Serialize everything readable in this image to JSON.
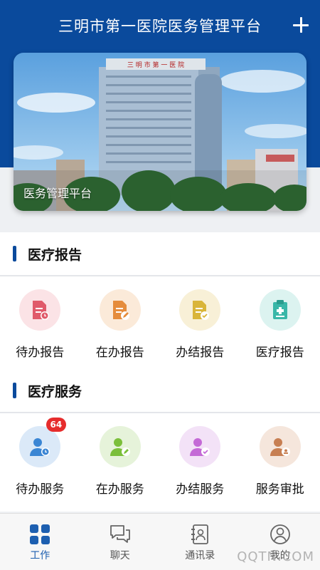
{
  "header": {
    "title": "三明市第一医院医务管理平台",
    "add_icon": "plus-icon"
  },
  "banner": {
    "caption": "医务管理平台",
    "building_sign": "三 明 市 第 一 医 院"
  },
  "reports": {
    "title": "医疗报告",
    "items": [
      {
        "label": "待办报告",
        "icon": "document-clock-icon",
        "color": "#e05a6a",
        "bg": "#fbe3e6"
      },
      {
        "label": "在办报告",
        "icon": "document-pen-icon",
        "color": "#e58c3c",
        "bg": "#fbead9"
      },
      {
        "label": "办结报告",
        "icon": "document-check-icon",
        "color": "#d9b53a",
        "bg": "#f8f0d7"
      },
      {
        "label": "医疗报告",
        "icon": "clipboard-icon",
        "color": "#39b7a8",
        "bg": "#dcf3f0"
      }
    ]
  },
  "services": {
    "title": "医疗服务",
    "items": [
      {
        "label": "待办服务",
        "icon": "user-clock-icon",
        "color": "#3b86d4",
        "bg": "#dbe9f8",
        "badge": "64"
      },
      {
        "label": "在办服务",
        "icon": "user-pen-icon",
        "color": "#7bbf3a",
        "bg": "#e6f3da"
      },
      {
        "label": "办结服务",
        "icon": "user-check-icon",
        "color": "#c46ad6",
        "bg": "#f3e2f7"
      },
      {
        "label": "服务审批",
        "icon": "user-approve-icon",
        "color": "#c77f52",
        "bg": "#f5e6dc"
      }
    ]
  },
  "tabbar": {
    "items": [
      {
        "label": "工作",
        "icon": "grid-icon",
        "active": true
      },
      {
        "label": "聊天",
        "icon": "chat-icon",
        "active": false
      },
      {
        "label": "通讯录",
        "icon": "contacts-icon",
        "active": false
      },
      {
        "label": "我的",
        "icon": "profile-icon",
        "active": false
      }
    ]
  },
  "watermark": "QQTN.COM",
  "colors": {
    "primary": "#0a4a9c",
    "tab_active": "#1d5fb0",
    "badge": "#e62c2c"
  }
}
